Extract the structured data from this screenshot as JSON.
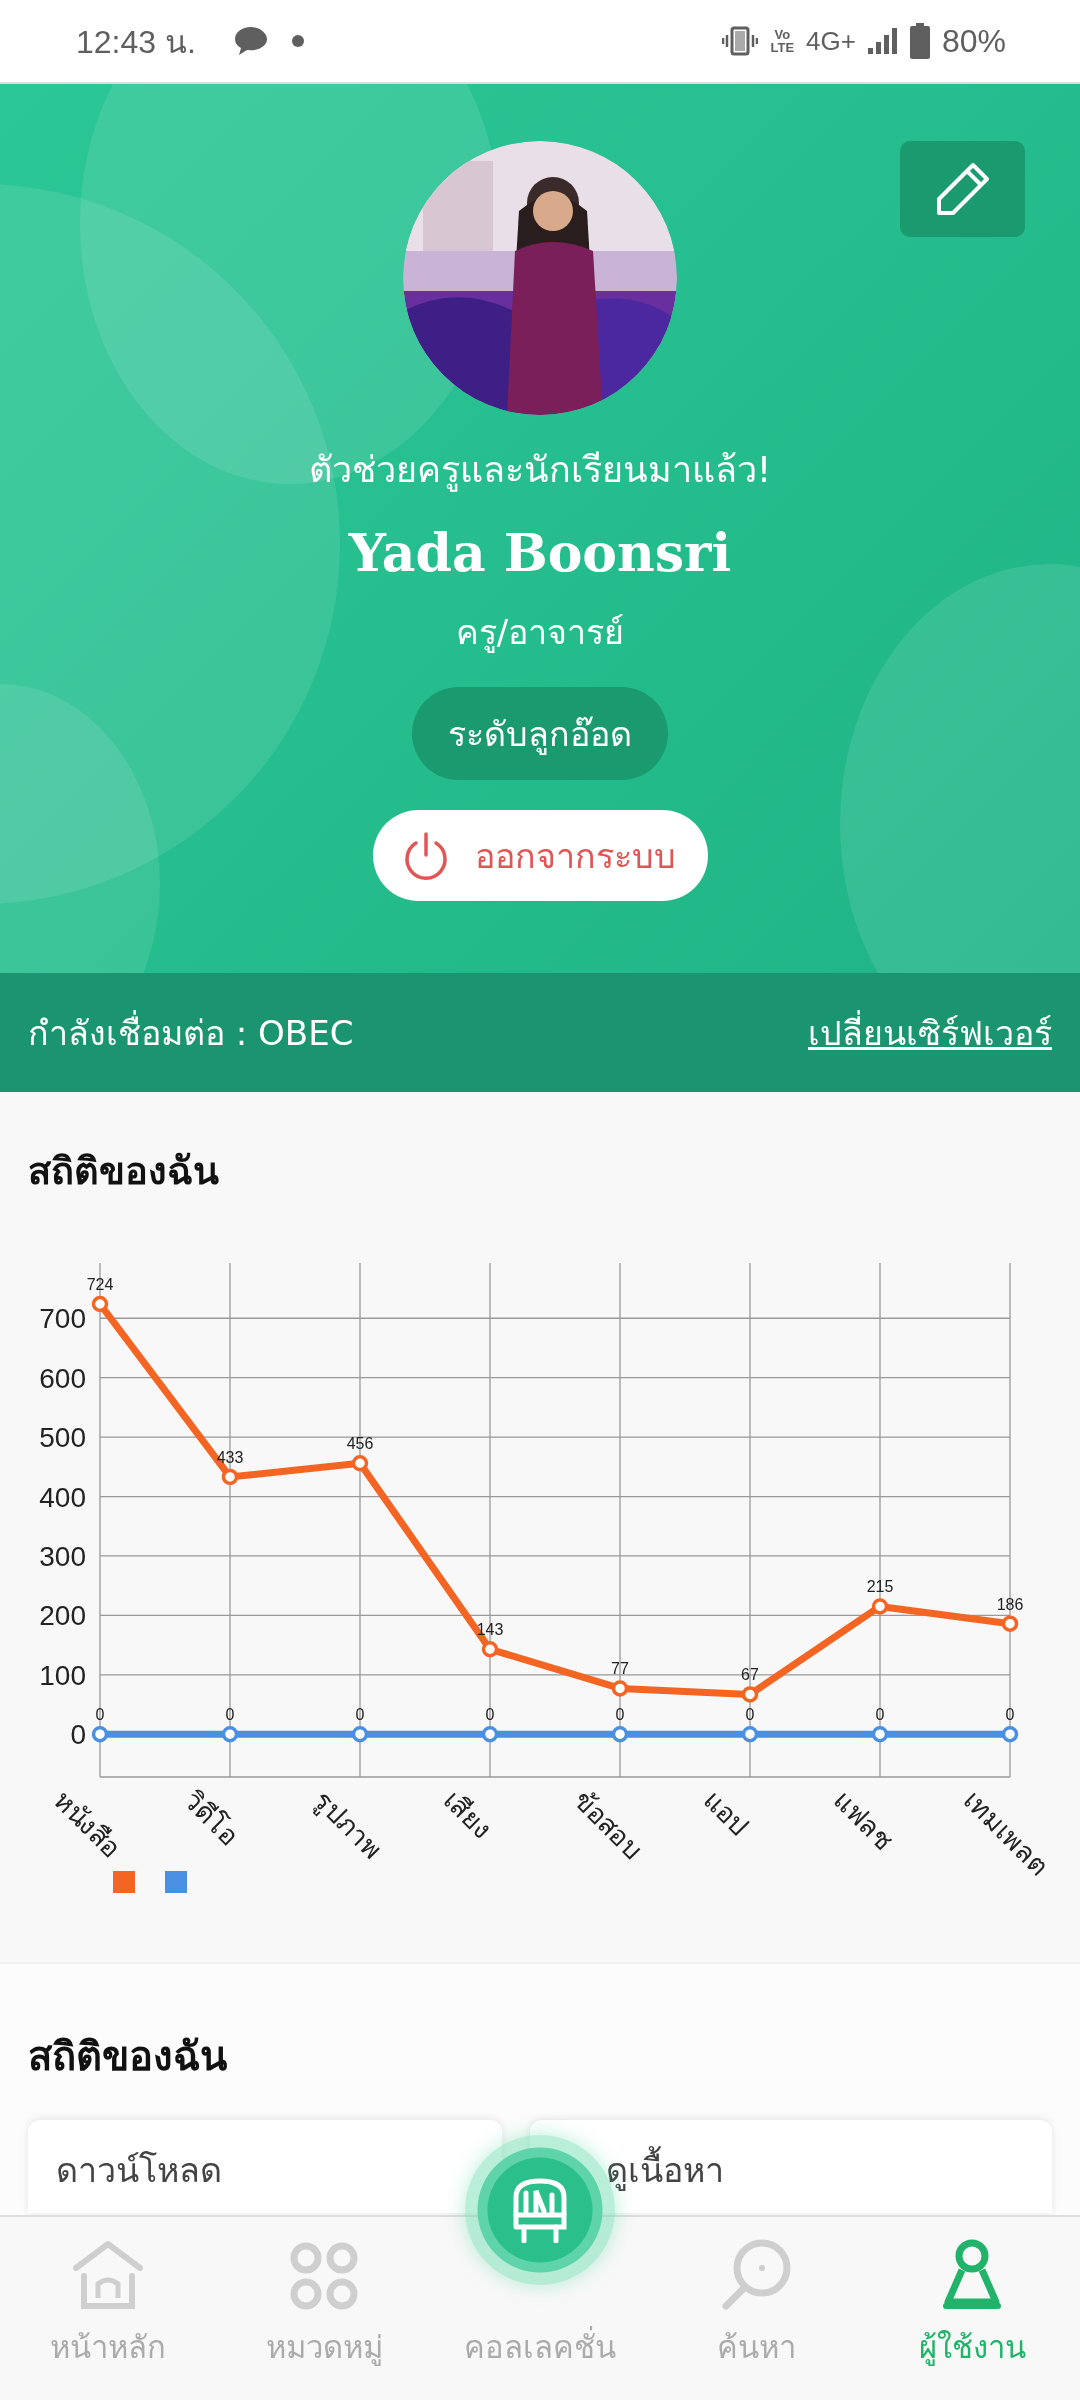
{
  "status_bar": {
    "time": "12:43 น.",
    "volte": [
      "Vo",
      "LTE"
    ],
    "network": "4G+",
    "battery": "80%"
  },
  "profile": {
    "tagline": "ตัวช่วยครูและนักเรียนมาแล้ว!",
    "name": "Yada Boonsri",
    "role": "ครู/อาจารย์",
    "level": "ระดับลูกอ๊อด",
    "logout": "ออกจากระบบ"
  },
  "connection": {
    "label": "กำลังเชื่อมต่อ : OBEC",
    "link": "เปลี่ยนเซิร์ฟเวอร์"
  },
  "stats_chart": {
    "title": "สถิติของฉัน",
    "chart_data": {
      "type": "line",
      "categories": [
        "หนังสือ",
        "วิดีโอ",
        "รูปภาพ",
        "เสียง",
        "ข้อสอบ",
        "แอป",
        "แฟลช",
        "เทมเพลต"
      ],
      "ylim": [
        -72,
        793
      ],
      "yticks": [
        0,
        100,
        200,
        300,
        400,
        500,
        600,
        700
      ],
      "data_labels": true,
      "grid": true,
      "series": [
        {
          "color": "#f46524",
          "marker": "circle",
          "values": [
            724,
            433,
            456,
            143,
            77,
            67,
            215,
            186
          ]
        },
        {
          "color": "#4a90e2",
          "marker": "circle",
          "values": [
            0,
            0,
            0,
            0,
            0,
            0,
            0,
            0
          ]
        }
      ]
    }
  },
  "stats_cards": {
    "title": "สถิติของฉัน",
    "cards": [
      {
        "label": "ดาวน์โหลด"
      },
      {
        "label": "ดูเนื้อหา"
      }
    ]
  },
  "bottom_nav": {
    "items": [
      {
        "kind": "home",
        "label": "หน้าหลัก",
        "selected": false
      },
      {
        "kind": "category",
        "label": "หมวดหมู่",
        "selected": false
      },
      {
        "kind": "collection",
        "label": "คอลเลคชั่น",
        "selected": false
      },
      {
        "kind": "search",
        "label": "ค้นหา",
        "selected": false
      },
      {
        "kind": "user",
        "label": "ผู้ใช้งาน",
        "selected": true
      }
    ]
  }
}
